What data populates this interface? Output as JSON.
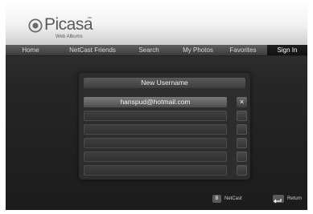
{
  "app": {
    "logo_text": "Picasa",
    "logo_tm": "™",
    "logo_subtitle": "Web Albums"
  },
  "nav": {
    "tabs": [
      {
        "label": "Home"
      },
      {
        "label": "NetCast Friends"
      },
      {
        "label": "Search"
      },
      {
        "label": "My Photos"
      },
      {
        "label": "Favorites"
      },
      {
        "label": "Sign In"
      }
    ],
    "active": "Sign In"
  },
  "signin": {
    "title": "New Username",
    "entries": [
      {
        "value": "hanspud@hotmail.com",
        "delete_glyph": "×"
      }
    ]
  },
  "footer": {
    "netcast_key": "B",
    "netcast_label": "NetCast",
    "return_label": "Return"
  },
  "colors": {
    "header_bg": "#f2f2f2",
    "nav_bg": "#4a4a4a",
    "active_tab_bg": "#151515",
    "screen_bg": "#262626"
  },
  "icons": {
    "logo": "picasa-pinwheel-icon",
    "delete": "close-icon",
    "return": "return-arrow-icon"
  }
}
